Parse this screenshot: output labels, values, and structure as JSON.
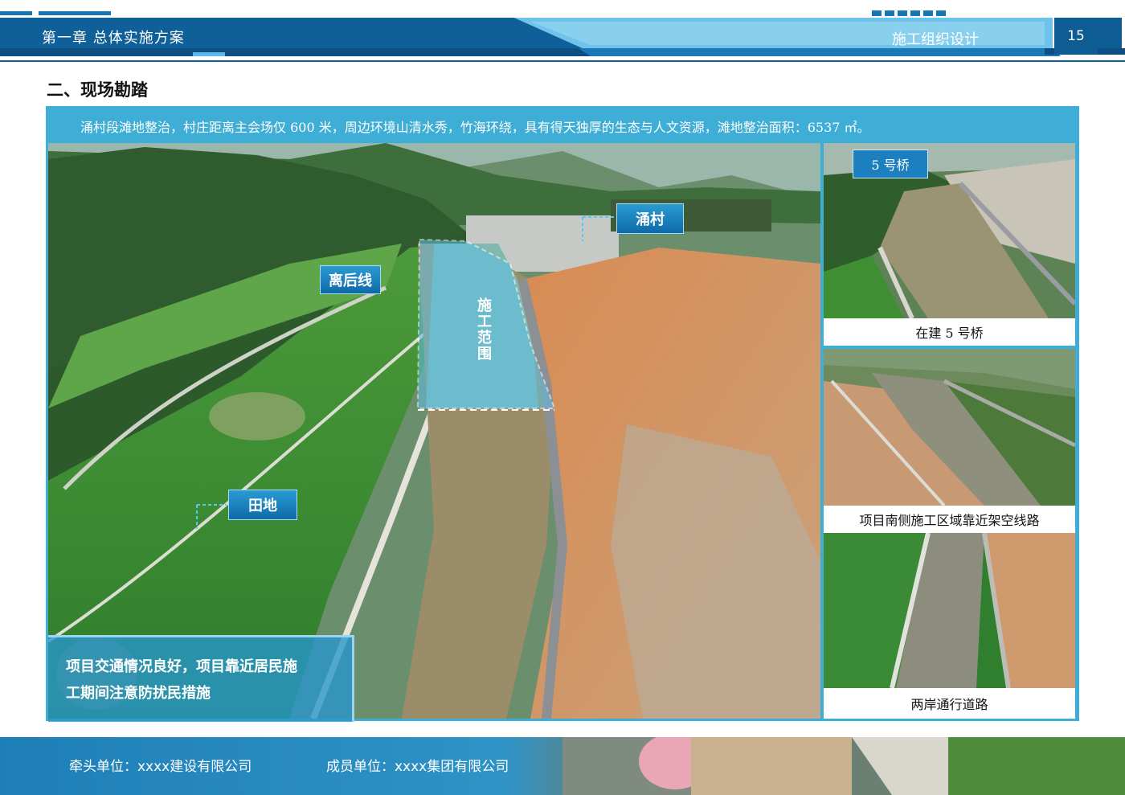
{
  "header": {
    "chapter": "第一章 总体实施方案",
    "section": "施工组织设计",
    "page_number": "15"
  },
  "section_title": "二、现场勘踏",
  "intro_text": "涌村段滩地整治，村庄距离主会场仅 600 米，周边环境山清水秀，竹海环绕，具有得天独厚的生态与人文资源，滩地整治面积：6537 ㎡。",
  "main_photo": {
    "labels": {
      "village": "涌村",
      "setback_line": "离后线",
      "construction_scope": "施工范围",
      "farmland": "田地"
    },
    "note": {
      "line1": "项目交通情况良好，项目靠近居民施",
      "line2": "工期间注意防扰民措施"
    }
  },
  "side_photos": [
    {
      "tag": "5 号桥",
      "caption": "在建 5 号桥"
    },
    {
      "caption": "项目南侧施工区域靠近架空线路"
    },
    {
      "caption": "两岸通行道路"
    }
  ],
  "footer": {
    "lead_unit": "牵头单位：xxxx建设有限公司",
    "member_unit": "成员单位：xxxx集团有限公司"
  },
  "colors": {
    "header_blue": "#0f5f99",
    "frame_blue": "#3eaed6",
    "label_blue": "#1b7fc0"
  }
}
